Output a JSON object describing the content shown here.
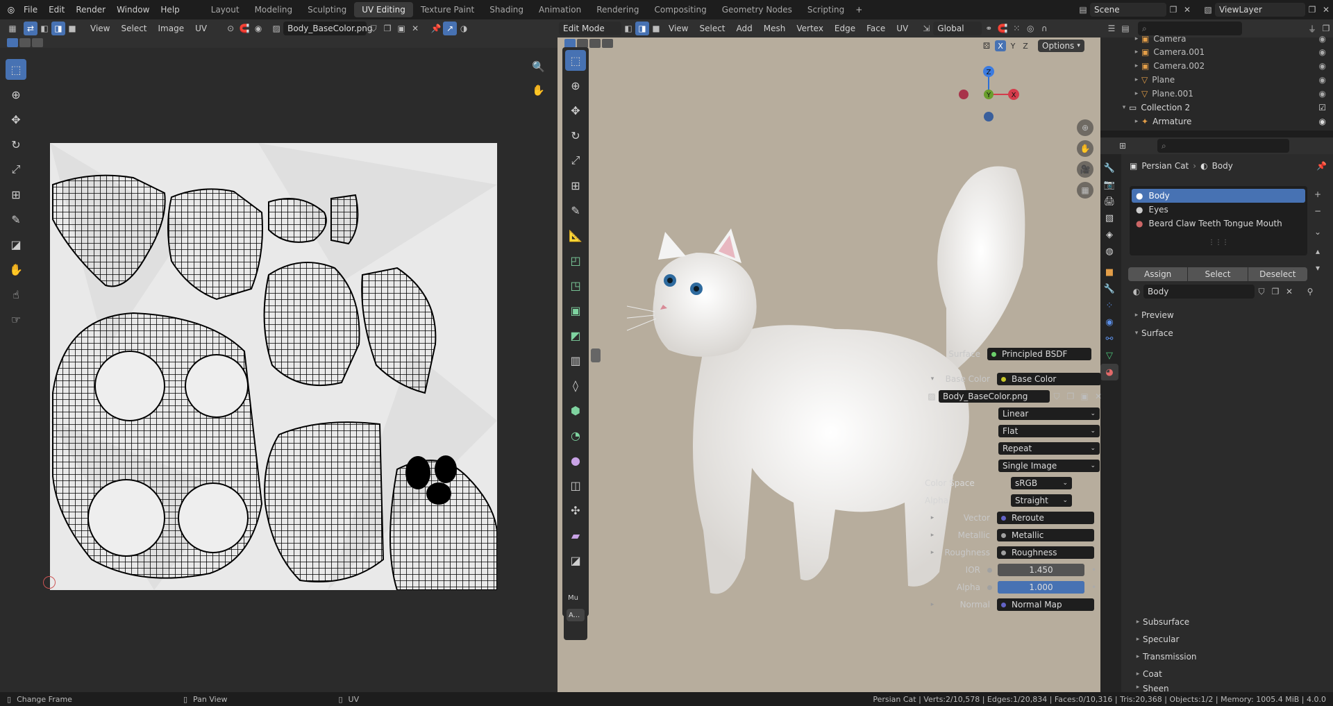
{
  "app": {
    "menus": [
      "File",
      "Edit",
      "Render",
      "Window",
      "Help"
    ]
  },
  "workspaces": [
    "Layout",
    "Modeling",
    "Sculpting",
    "UV Editing",
    "Texture Paint",
    "Shading",
    "Animation",
    "Rendering",
    "Compositing",
    "Geometry Nodes",
    "Scripting"
  ],
  "active_workspace": "UV Editing",
  "scene": {
    "name": "Scene",
    "view_layer": "ViewLayer"
  },
  "uv_editor": {
    "menus": [
      "View",
      "Select",
      "Image",
      "UV"
    ],
    "image_name": "Body_BaseColor.png"
  },
  "viewport": {
    "mode": "Edit Mode",
    "menus": [
      "View",
      "Select",
      "Add",
      "Mesh",
      "Vertex",
      "Edge",
      "Face",
      "UV"
    ],
    "orientation": "Global",
    "options": "Options",
    "axes": [
      "X",
      "Y",
      "Z"
    ],
    "gizmo_axes": {
      "x": "X",
      "y": "Y",
      "z": "Z"
    },
    "last_op": {
      "label": "Mu",
      "button": "A..."
    }
  },
  "outliner": {
    "items": [
      {
        "name": "Camera"
      },
      {
        "name": "Camera.001"
      },
      {
        "name": "Camera.002"
      },
      {
        "name": "Plane"
      },
      {
        "name": "Plane.001"
      },
      {
        "name": "Collection 2"
      },
      {
        "name": "Armature"
      }
    ]
  },
  "properties": {
    "breadcrumb": {
      "object": "Persian Cat",
      "material": "Body"
    },
    "slots": [
      "Body",
      "Eyes",
      "Beard Claw Teeth Tongue Mouth"
    ],
    "slot_buttons": {
      "assign": "Assign",
      "select": "Select",
      "deselect": "Deselect"
    },
    "material_name": "Body",
    "panels": {
      "preview": "Preview",
      "surface": "Surface"
    },
    "surface": {
      "label": "Surface",
      "value": "Principled BSDF"
    },
    "base_color": {
      "label": "Base Color",
      "value": "Base Color"
    },
    "image_node": {
      "image": "Body_BaseColor.png",
      "interpolation": "Linear",
      "projection": "Flat",
      "extension": "Repeat",
      "source": "Single Image"
    },
    "color_space": {
      "label": "Color Space",
      "value": "sRGB"
    },
    "alpha_mode": {
      "label": "Alpha",
      "value": "Straight"
    },
    "inputs": [
      {
        "label": "Vector",
        "value": "Reroute"
      },
      {
        "label": "Metallic",
        "value": "Metallic"
      },
      {
        "label": "Roughness",
        "value": "Roughness"
      }
    ],
    "ior": {
      "label": "IOR",
      "value": "1.450"
    },
    "alpha": {
      "label": "Alpha",
      "value": "1.000",
      "fill": 1.0
    },
    "normal": {
      "label": "Normal",
      "value": "Normal Map"
    },
    "subpanels": [
      "Subsurface",
      "Specular",
      "Transmission",
      "Coat",
      "Sheen"
    ]
  },
  "statusbar": {
    "hints": [
      "Change Frame",
      "Pan View",
      "UV"
    ],
    "stats": "Persian Cat | Verts:2/10,578 | Edges:1/20,834 | Faces:0/10,316 | Tris:20,368 | Objects:1/2 | Memory: 1005.4 MiB | 4.0.0"
  },
  "colors": {
    "accent": "#4772b3",
    "bg": "#1d1d1d",
    "panel": "#303030",
    "viewport_bg": "#b7ad9d",
    "uv_bg": "#2b2b2b"
  }
}
